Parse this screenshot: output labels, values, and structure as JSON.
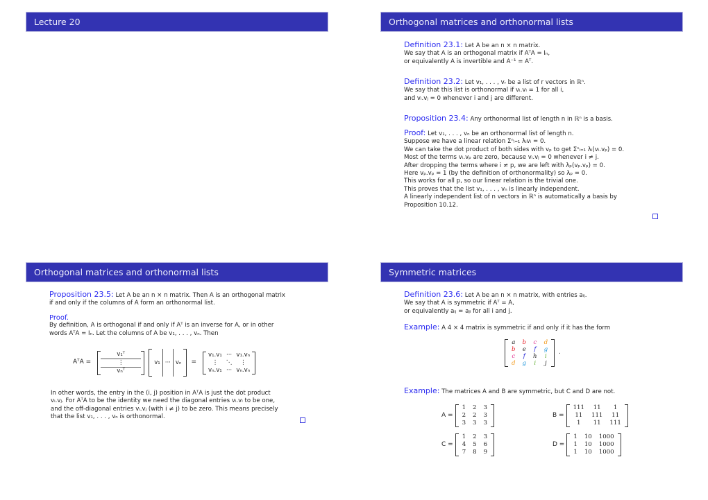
{
  "slides": [
    {
      "title": "Lecture 20"
    },
    {
      "title": "Orthogonal matrices and orthonormal lists",
      "def1": {
        "label": "Definition 23.1:",
        "lines": [
          "Let A be an n × n matrix.",
          "We say that A is an orthogonal matrix if AᵀA = Iₙ,",
          "or equivalently A is invertible and A⁻¹ = Aᵀ."
        ]
      },
      "def2": {
        "label": "Definition 23.2:",
        "lines": [
          "Let v₁, . . . , vᵣ be a list of r vectors in ℝⁿ.",
          "We say that this list is orthonormal if vᵢ.vᵢ = 1 for all i,",
          "and vᵢ.vⱼ = 0 whenever i and j are different."
        ]
      },
      "prop": {
        "label": "Proposition 23.4:",
        "text": "Any orthonormal list of length n in ℝⁿ is a basis."
      },
      "proof": {
        "label": "Proof:",
        "lines": [
          "Let v₁, . . . , vₙ be an orthonormal list of length n.",
          "Suppose we have a linear relation Σⁿᵢ₌₁ λᵢvᵢ = 0.",
          "We can take the dot product of both sides with vₚ to get Σⁿᵢ₌₁ λᵢ(vᵢ.vₚ) = 0.",
          "Most of the terms vᵢ.vₚ are zero, because vᵢ.vⱼ = 0 whenever i ≠ j.",
          "After dropping the terms where i ≠ p, we are left with λₚ(vₚ.vₚ) = 0.",
          "Here vₚ.vₚ = 1 (by the definition of orthonormality) so λₚ = 0.",
          "This works for all p, so our linear relation is the trivial one.",
          "This proves that the list v₁, . . . , vₙ is linearly independent.",
          "A linearly independent list of n vectors in ℝⁿ is automatically a basis by",
          "Proposition 10.12."
        ]
      }
    },
    {
      "title": "Orthogonal matrices and orthonormal lists",
      "prop": {
        "label": "Proposition 23.5:",
        "lines": [
          "Let A be an n × n matrix. Then A is an orthogonal matrix",
          "if and only if the columns of A form an orthonormal list."
        ]
      },
      "proof_label": "Proof.",
      "proof_lines": [
        "By definition, A is orthogonal if and only if Aᵀ is an inverse for A, or in other",
        "words AᵀA = Iₙ. Let the columns of A be v₁, . . . , vₙ. Then"
      ],
      "eq": {
        "lhs": "AᵀA =",
        "rows": [
          "v₁ᵀ",
          "⋮",
          "vₙᵀ"
        ],
        "cols": [
          "v₁",
          "···",
          "vₙ"
        ],
        "eq": "=",
        "result": [
          [
            "v₁.v₁",
            "···",
            "v₁.vₙ"
          ],
          [
            "⋮",
            "⋱",
            "⋮"
          ],
          [
            "vₙ.v₁",
            "···",
            "vₙ.vₙ"
          ]
        ]
      },
      "after_lines": [
        "In other words, the entry in the (i, j) position in AᵀA is just the dot product",
        "vᵢ.vⱼ. For AᵀA to be the identity we need the diagonal entries vᵢ.vᵢ to be one,",
        "and the off-diagonal entries vᵢ.vⱼ (with i ≠ j) to be zero. This means precisely",
        "that the list v₁, . . . , vₙ is orthonormal."
      ]
    },
    {
      "title": "Symmetric matrices",
      "def": {
        "label": "Definition 23.6:",
        "lines": [
          "Let A be an n × n matrix, with entries aᵢⱼ.",
          "We say that A is symmetric if Aᵀ = A,",
          "or equivalently aᵢⱼ = aⱼᵢ for all i and j."
        ]
      },
      "ex1": {
        "label": "Example:",
        "text": "A 4 × 4 matrix is symmetric if and only if it has the form"
      },
      "sym": {
        "cells": [
          [
            "a",
            "b",
            "c",
            "d"
          ],
          [
            "b",
            "e",
            "f",
            "g"
          ],
          [
            "c",
            "f",
            "h",
            "i"
          ],
          [
            "d",
            "g",
            "i",
            "j"
          ]
        ],
        "colors": {
          "a": "#222222",
          "e": "#222222",
          "h": "#222222",
          "j": "#222222",
          "b": "#e8262f",
          "c": "#e0308f",
          "d": "#f39a1c",
          "f": "#2424d8",
          "g": "#2a9bdc",
          "i": "#5aaa2a"
        },
        "trail": "."
      },
      "ex2": {
        "label": "Example:",
        "text": "The matrices A and B are symmetric, but C and D are not."
      },
      "matrices": [
        {
          "name": "A =",
          "rows": [
            [
              "1",
              "2",
              "3"
            ],
            [
              "2",
              "2",
              "3"
            ],
            [
              "3",
              "3",
              "3"
            ]
          ]
        },
        {
          "name": "B =",
          "rows": [
            [
              "111",
              "11",
              "1"
            ],
            [
              "11",
              "111",
              "11"
            ],
            [
              "1",
              "11",
              "111"
            ]
          ]
        },
        {
          "name": "C =",
          "rows": [
            [
              "1",
              "2",
              "3"
            ],
            [
              "4",
              "5",
              "6"
            ],
            [
              "7",
              "8",
              "9"
            ]
          ]
        },
        {
          "name": "D =",
          "rows": [
            [
              "1",
              "10",
              "1000"
            ],
            [
              "1",
              "10",
              "1000"
            ],
            [
              "1",
              "10",
              "1000"
            ]
          ]
        }
      ]
    }
  ],
  "colors": {
    "header_bg": "#3333b2",
    "header_text": "#ececfa",
    "theorem_blue": "#2a2af0",
    "text": "#222222"
  }
}
